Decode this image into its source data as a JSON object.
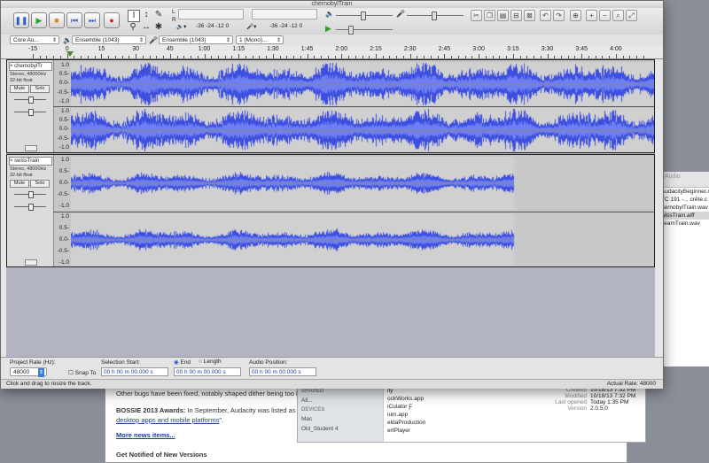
{
  "window": {
    "title": "chernobylTrain"
  },
  "toolbar": {
    "transport": {
      "pause": "❚❚",
      "play": "▶",
      "stop": "■",
      "skip_start": "⏮",
      "skip_end": "⏭",
      "record": "●"
    },
    "tools": {
      "select": "I",
      "envelope": "↕",
      "draw": "✎",
      "zoom": "⚲",
      "timeshift": "↔",
      "multi": "✱"
    },
    "meter_top_labels": [
      "L",
      "R"
    ],
    "meter_scale": "-36  -24  -12  0",
    "meter_scale2": "-36  -24  -12  0",
    "play_meter_scale": "-36  -24  -12  0",
    "play_meter_scale2": "-36  -24  -12  0"
  },
  "device": {
    "host": "Core Au...",
    "output": "Ensemble (1043)",
    "input": "Ensemble (1043)",
    "channels": "1 (Mono)..."
  },
  "ruler": {
    "labels": [
      "-15",
      "0",
      "15",
      "30",
      "45",
      "1:00",
      "1:15",
      "1:30",
      "1:45",
      "2:00",
      "2:15",
      "2:30",
      "2:45",
      "3:00",
      "3:15",
      "3:30",
      "3:45",
      "4:00"
    ]
  },
  "tracks": [
    {
      "name": "chernobylTr",
      "format": "Stereo, 48000Hz",
      "bits": "32-bit float",
      "mute": "Mute",
      "solo": "Solo",
      "duration_fraction": 1.0
    },
    {
      "name": "swissTrain",
      "format": "Stereo, 48000Hz",
      "bits": "32-bit float",
      "mute": "Mute",
      "solo": "Solo",
      "duration_fraction": 0.76
    }
  ],
  "vscale": [
    "1.0",
    "0.5-",
    "0.0-",
    "-0.5-",
    "-1.0"
  ],
  "selection": {
    "project_rate_label": "Project Rate (Hz):",
    "project_rate": "48000",
    "snap_to": "Snap To",
    "selection_start_label": "Selection Start:",
    "end": "End",
    "length": "Length",
    "audio_position_label": "Audio Position:",
    "start_value": "00 h 00 m 00.000 s",
    "end_value": "00 h 00 m 00.000 s",
    "position_value": "00 h 00 m 00.000 s"
  },
  "status": {
    "left": "Click and drag to resize the track.",
    "right": "Actual Rate: 48000"
  },
  "bg_web": {
    "line1": "Other bugs have been fixed, notably shaped dither being too lo",
    "bossie_bold": "BOSSIE 2013 Awards:",
    "bossie_text": " In September, Audacity was listed as a",
    "bossie_link": "desktop apps and mobile platforms",
    "bossie_end": "\".",
    "more_news": "More news items...",
    "notified": "Get Notified of New Versions"
  },
  "bg_finder": {
    "shared": "SHARED",
    "all": "All...",
    "devices": "DEVICES",
    "mac": "Mac",
    "old": "Old_Student 4",
    "col": [
      "ity",
      "ockWorks.app",
      "iCulator Ƒ",
      "ium.app",
      "eldaProduction",
      "ertPlayer"
    ],
    "info": [
      [
        "Created",
        "10/18/13 7:32 PM"
      ],
      [
        "Modified",
        "10/18/13 7:32 PM"
      ],
      [
        "Last opened",
        "Today 1:35 PM"
      ],
      [
        "Version",
        "2.0.5.0"
      ]
    ]
  },
  "bg_finder_right": {
    "header": "eAudio",
    "rows": [
      "AudacityBeginner.m",
      "TC 191 -... crête.c",
      "hernobylTrain.wav",
      "wissTrain.aiff",
      "ceamTrain.wav"
    ],
    "selected_index": 3
  },
  "colors": {
    "wave": "#3c4fe0",
    "wave_light": "#6f7ff0",
    "track_bg": "#c6c6c6",
    "selected": "#b2b4c4"
  }
}
